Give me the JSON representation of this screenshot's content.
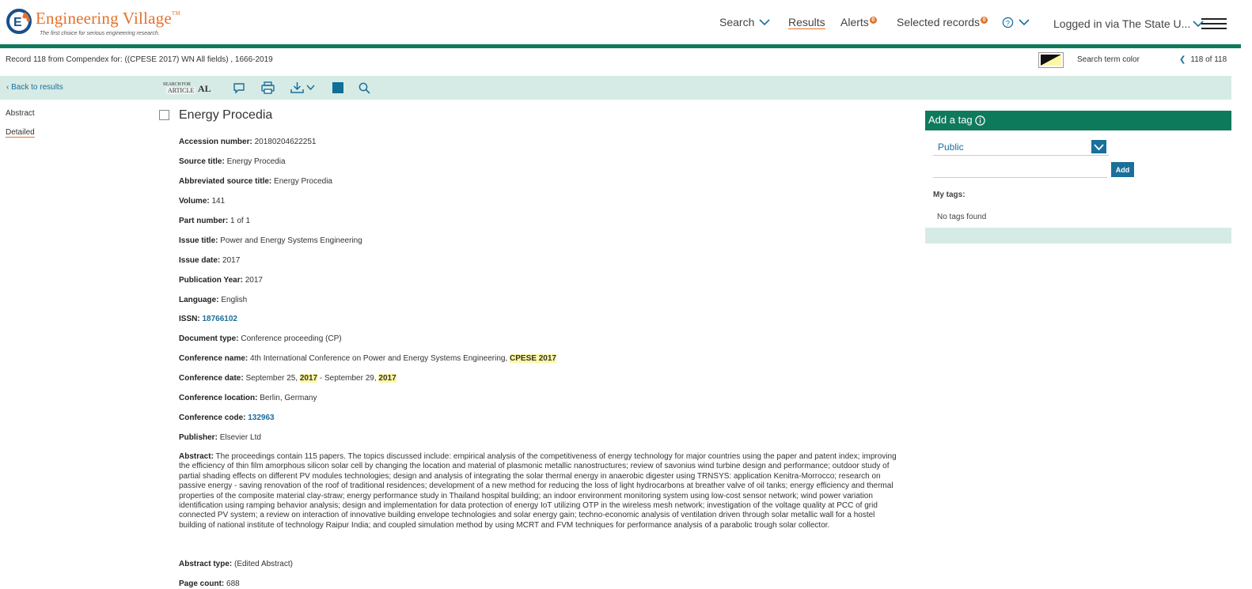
{
  "brand": {
    "title": "Engineering Village",
    "trademark": "TM",
    "tagline": "The first choice for serious engineering research."
  },
  "nav": {
    "search": "Search",
    "results": "Results",
    "alerts": "Alerts",
    "alerts_count": "0",
    "selected_records": "Selected records",
    "selected_count": "0",
    "login": "Logged in via The State U..."
  },
  "record_bar": {
    "record_line": "Record 118 from Compendex for: ((CPESE 2017) WN All fields) , 1666-2019",
    "search_term_color": "Search term color",
    "pager": "118 of 118"
  },
  "toolbar": {
    "back": "Back to results",
    "sfa_line1": "SEARCH FOR",
    "sfa_line2": "ARTICLE",
    "sfa_mark": "AL"
  },
  "leftnav": {
    "abstract": "Abstract",
    "detailed": "Detailed"
  },
  "record": {
    "title": "Energy Procedia",
    "fields": {
      "accession_label": "Accession number:",
      "accession": "20180204622251",
      "source_label": "Source title:",
      "source": "Energy Procedia",
      "abbr_label": "Abbreviated source title:",
      "abbr": "Energy Procedia",
      "volume_label": "Volume:",
      "volume": "141",
      "part_label": "Part number:",
      "part": "1 of 1",
      "issue_title_label": "Issue title:",
      "issue_title": "Power and Energy Systems Engineering",
      "issue_date_label": "Issue date:",
      "issue_date": "2017",
      "pub_year_label": "Publication Year:",
      "pub_year": "2017",
      "language_label": "Language:",
      "language": "English",
      "issn_label": "ISSN:",
      "issn": "18766102",
      "doctype_label": "Document type:",
      "doctype": "Conference proceeding (CP)",
      "conf_name_label": "Conference name:",
      "conf_name": "4th International Conference on Power and Energy Systems Engineering,",
      "conf_name_hl": "CPESE 2017",
      "conf_date_label": "Conference date:",
      "conf_date_a": "September 25,",
      "conf_date_hl1": "2017",
      "conf_date_b": "- September 29,",
      "conf_date_hl2": "2017",
      "conf_loc_label": "Conference location:",
      "conf_loc": "Berlin, Germany",
      "conf_code_label": "Conference code:",
      "conf_code": "132963",
      "publisher_label": "Publisher:",
      "publisher": "Elsevier Ltd",
      "abstract_label": "Abstract:",
      "abstract": "The proceedings contain 115 papers. The topics discussed include: empirical analysis of the competitiveness of energy technology for major countries using the paper and patent index; improving the efficiency of thin film amorphous silicon solar cell by changing the location and material of plasmonic metallic nanostructures; review of savonius wind turbine design and performance; outdoor study of partial shading effects on different PV modules technologies; design and analysis of integrating the solar thermal energy in anaerobic digester using TRNSYS: application Kenitra-Morrocco; research on passive energy - saving renovation of the roof of traditional residences; development of a new method for reducing the loss of light hydrocarbons at breather valve of oil tanks; energy efficiency and thermal properties of the composite material clay-straw; energy performance study in Thailand hospital building; an indoor environment monitoring system using low-cost sensor network; wind power variation identification using ramping behavior analysis; design and implementation for data protection of energy IoT utilizing OTP in the wireless mesh network; investigation of the voltage quality at PCC of grid connected PV system; a review on interaction of innovative building envelope technologies and solar energy gain; techno-economic analysis of ventilation driven through solar metallic wall for a hostel building of national institute of technology Raipur India; and coupled simulation method by using MCRT and FVM techniques for performance analysis of a parabolic trough solar collector.",
      "abstract_type_label": "Abstract type:",
      "abstract_type": "(Edited Abstract)",
      "page_count_label": "Page count:",
      "page_count": "688"
    }
  },
  "tags": {
    "header": "Add a tag",
    "scope": "Public",
    "add": "Add",
    "my_tags": "My tags:",
    "empty": "No tags found"
  },
  "colors": {
    "brand_orange": "#e4712a",
    "brand_green": "#0e7a5c",
    "link_blue": "#1a6f9b",
    "toolbar_bg": "#d6ebe5",
    "highlight": "#fdf7a5"
  },
  "icons": [
    "logo-mark-icon",
    "chevron-down-icon",
    "help-icon",
    "hamburger-menu-icon",
    "chevron-left-icon",
    "comment-icon",
    "print-icon",
    "download-icon",
    "square-icon",
    "search-icon",
    "info-icon",
    "checkmark-chevron-icon"
  ]
}
